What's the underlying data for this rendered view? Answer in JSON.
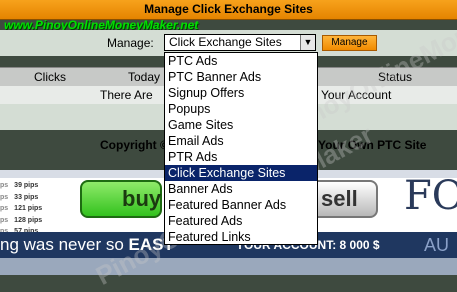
{
  "window": {
    "title": "Manage Click Exchange Sites"
  },
  "watermark": {
    "url": "www.PinoyOnlineMoneyMaker.net",
    "diagonal": "PinoyOnlineMoneyMaker"
  },
  "manage": {
    "label": "Manage:",
    "selected": "Click Exchange Sites",
    "button_label": "Manage"
  },
  "table": {
    "columns": [
      "Clicks",
      "Today",
      "Status"
    ],
    "row_left": "There Are",
    "row_right": "Your Account"
  },
  "footer": {
    "left": "Copyright © 2",
    "right": "Your Own PTC Site"
  },
  "dropdown": {
    "options": [
      "PTC Ads",
      "PTC Banner Ads",
      "Signup Offers",
      "Popups",
      "Game Sites",
      "Email Ads",
      "PTR Ads",
      "Click Exchange Sites",
      "Banner Ads",
      "Featured Banner Ads",
      "Featured Ads",
      "Featured Links"
    ],
    "selected_index": 7
  },
  "banner": {
    "pips": [
      {
        "a": "ps",
        "b": "39 pips"
      },
      {
        "a": "ps",
        "b": "33 pips"
      },
      {
        "a": "ps",
        "b": "121 pips"
      },
      {
        "a": "ps",
        "b": "128 pips"
      },
      {
        "a": "ps",
        "b": "57 pips"
      }
    ],
    "buy": "buy",
    "sell": "sell",
    "brand_partial": "FO",
    "slogan_start": "ng was never so ",
    "slogan_bold": "EAST",
    "account": "YOUR ACCOUNT:  8 000  $",
    "au": "AU"
  },
  "colors": {
    "title_bar": "#f29412",
    "selection": "#0a246a",
    "watermark_green": "#00e000"
  }
}
